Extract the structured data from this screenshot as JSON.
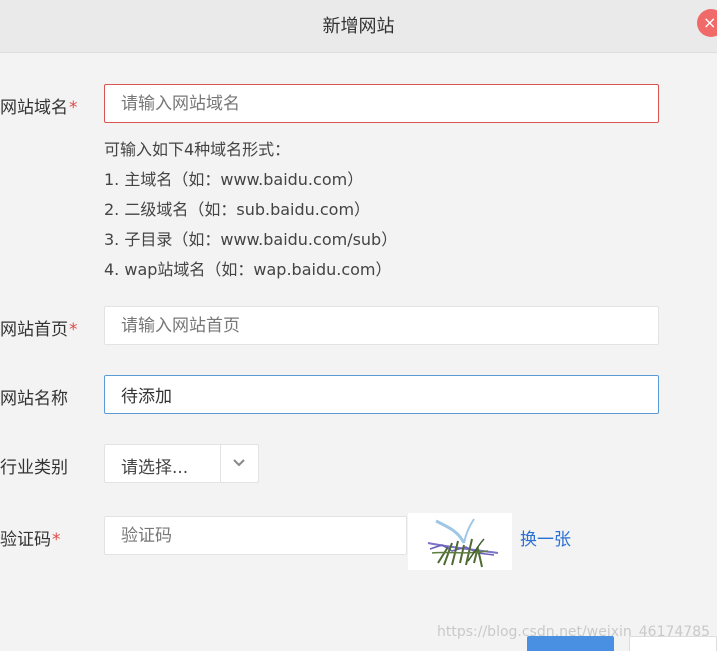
{
  "dialog": {
    "title": "新增网站",
    "close_glyph": "×"
  },
  "form": {
    "domain": {
      "label": "网站域名",
      "required_mark": "*",
      "placeholder": "请输入网站域名",
      "value": ""
    },
    "hints": [
      "可输入如下4种域名形式：",
      "1. 主域名（如：www.baidu.com）",
      "2. 二级域名（如：sub.baidu.com）",
      "3. 子目录（如：www.baidu.com/sub）",
      "4. wap站域名（如：wap.baidu.com）"
    ],
    "homepage": {
      "label": "网站首页",
      "required_mark": "*",
      "placeholder": "请输入网站首页",
      "value": ""
    },
    "site_name": {
      "label": "网站名称",
      "value": "待添加"
    },
    "industry": {
      "label": "行业类别",
      "selected": "请选择..."
    },
    "captcha": {
      "label": "验证码",
      "required_mark": "*",
      "placeholder": "验证码",
      "value": "",
      "refresh_label": "换一张"
    }
  },
  "watermark": "https://blog.csdn.net/weixin_46174785",
  "icons": {
    "close": "close-icon",
    "dropdown": "chevron-down-icon"
  },
  "colors": {
    "error_border": "#d9534f",
    "focus_border": "#5b9bd5",
    "link": "#2a6fd6",
    "required": "#e04a4a",
    "close_button": "#f06a6a",
    "primary_button": "#4a90e2"
  }
}
